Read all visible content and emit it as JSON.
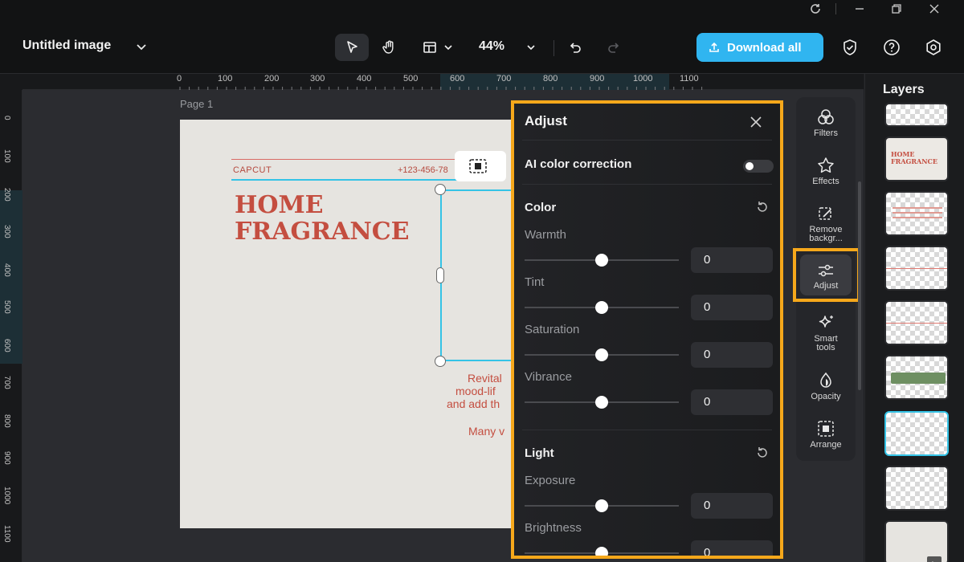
{
  "window": {
    "controls": [
      "refresh",
      "minimize",
      "restore",
      "close"
    ]
  },
  "header": {
    "doc_title": "Untitled image",
    "zoom": "44%",
    "download_label": "Download all"
  },
  "ruler": {
    "top_ticks": [
      "0",
      "100",
      "200",
      "300",
      "400",
      "500",
      "600",
      "700",
      "800",
      "900",
      "1000",
      "1100"
    ],
    "left_ticks": [
      "0",
      "100",
      "200",
      "300",
      "400",
      "500",
      "600",
      "700",
      "800",
      "900",
      "1000",
      "1100"
    ]
  },
  "canvas": {
    "page_label": "Page 1",
    "brand": "CAPCUT",
    "phone": "+123-456-78",
    "headline_1": "HOME",
    "headline_2": "FRAGRANCE",
    "body_1": "Revital",
    "body_2": "mood-lif",
    "body_3": "and add th",
    "body_4": "Many v"
  },
  "adjust": {
    "title": "Adjust",
    "ai_label": "AI color correction",
    "color_section": "Color",
    "light_section": "Light",
    "sliders_color": [
      {
        "label": "Warmth",
        "value": "0"
      },
      {
        "label": "Tint",
        "value": "0"
      },
      {
        "label": "Saturation",
        "value": "0"
      },
      {
        "label": "Vibrance",
        "value": "0"
      }
    ],
    "sliders_light": [
      {
        "label": "Exposure",
        "value": "0"
      },
      {
        "label": "Brightness",
        "value": "0"
      }
    ]
  },
  "tools": {
    "filters": "Filters",
    "effects": "Effects",
    "remove_bg_1": "Remove",
    "remove_bg_2": "backgr...",
    "adjust": "Adjust",
    "smart_1": "Smart",
    "smart_2": "tools",
    "opacity": "Opacity",
    "arrange": "Arrange"
  },
  "layers": {
    "title": "Layers",
    "thumb_text_1": "HOME",
    "thumb_text_2": "FRAGRANCE"
  },
  "colors": {
    "accent": "#30b5f0",
    "highlight": "#f6a81b",
    "selection": "#35c3e6",
    "headline": "#c44e40"
  }
}
